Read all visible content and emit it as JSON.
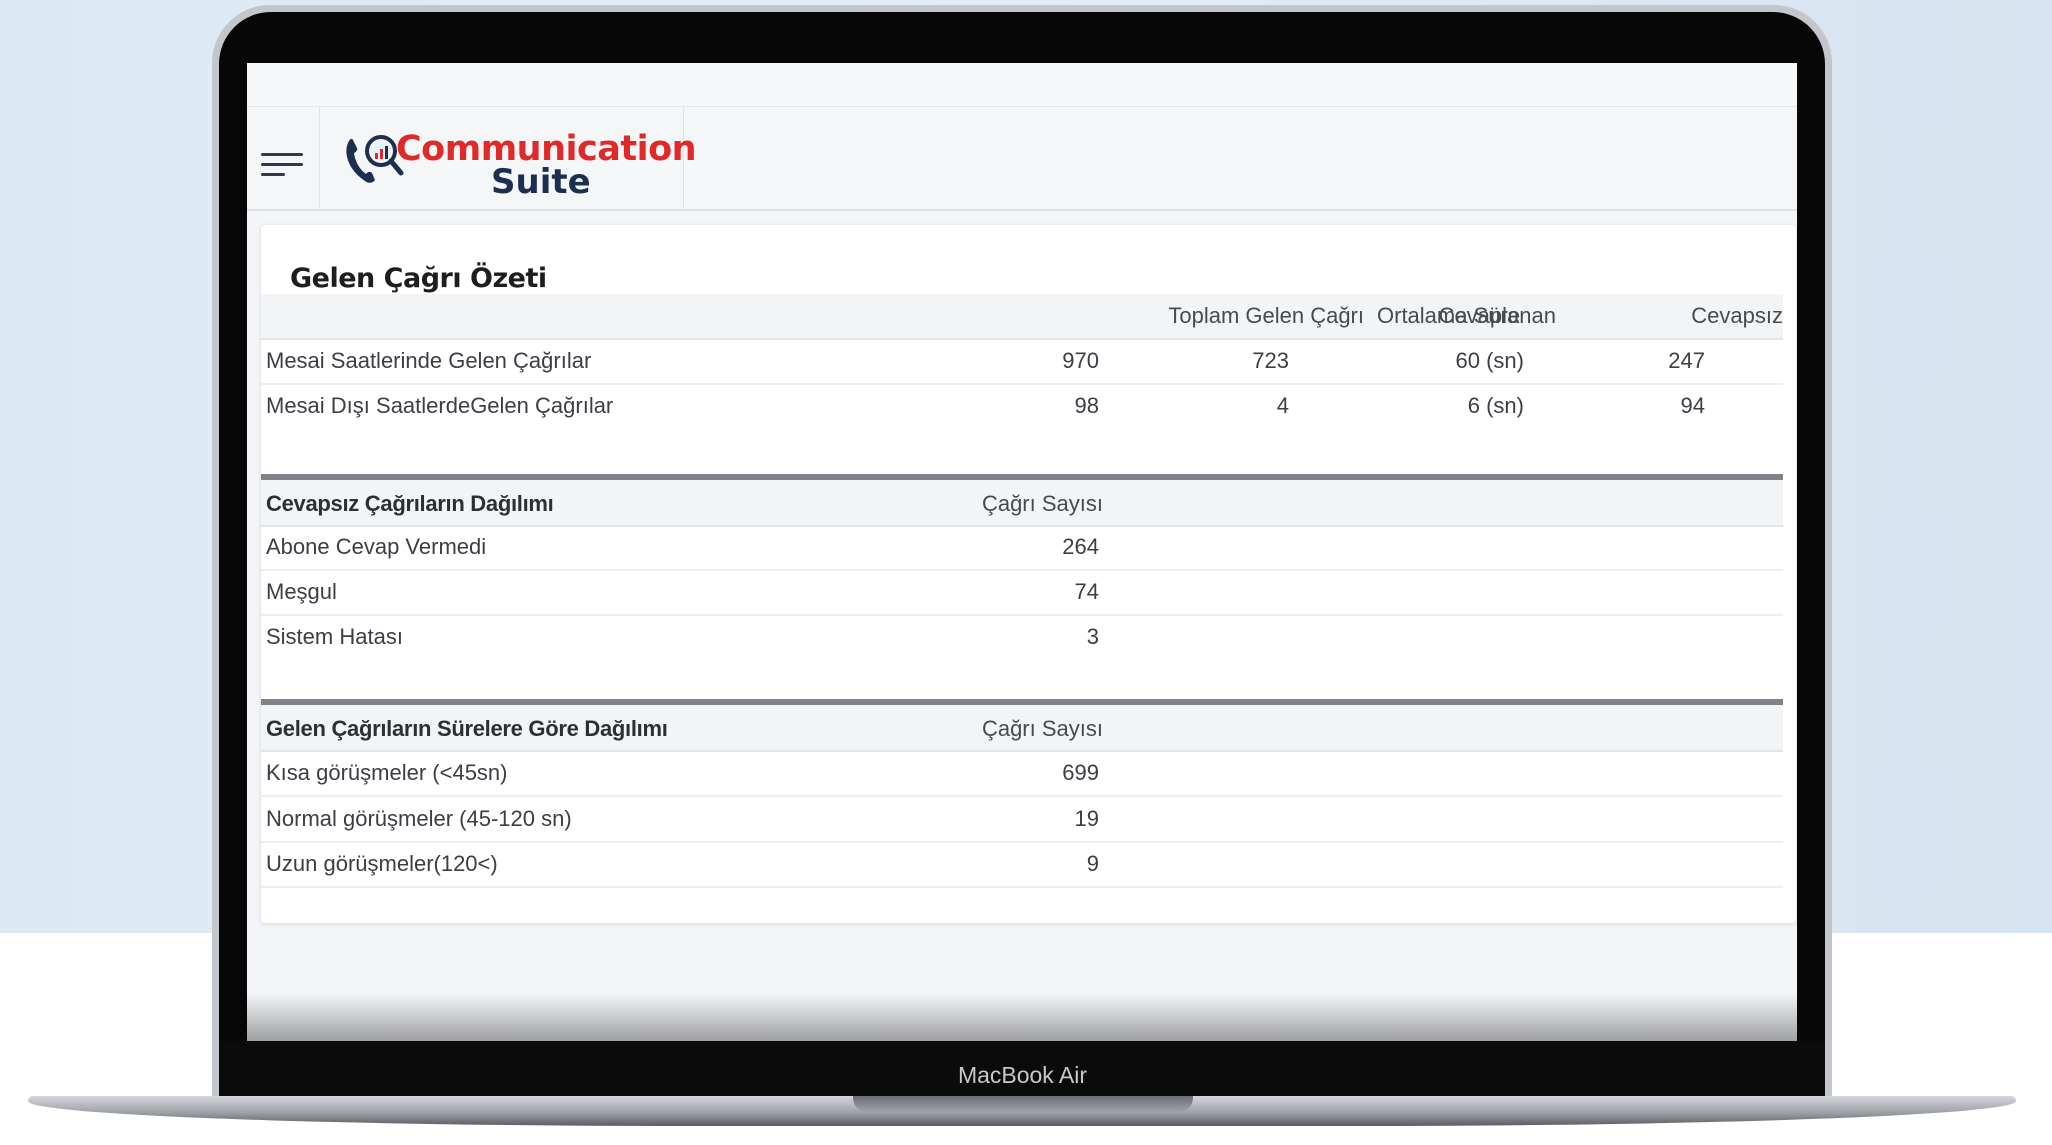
{
  "device": {
    "label": "MacBook Air"
  },
  "app": {
    "logo": {
      "line1": "Communication",
      "line2": "Suite"
    }
  },
  "report": {
    "title": "Gelen Çağrı Özeti",
    "summary": {
      "headers": [
        "",
        "Toplam Gelen Çağrı",
        "Cevaplanan",
        "Ortalama Süre",
        "Cevapsız"
      ],
      "rows": [
        {
          "label": "Mesai Saatlerinde Gelen Çağrılar",
          "total": "970",
          "answered": "723",
          "avg": "60 (sn)",
          "missed": "247"
        },
        {
          "label": "Mesai Dışı SaatlerdeGelen Çağrılar",
          "total": "98",
          "answered": "4",
          "avg": "6 (sn)",
          "missed": "94"
        }
      ]
    },
    "unanswered": {
      "title": "Cevapsız Çağrıların Dağılımı",
      "count_header": "Çağrı Sayısı",
      "rows": [
        {
          "label": "Abone Cevap Vermedi",
          "count": "264"
        },
        {
          "label": "Meşgul",
          "count": "74"
        },
        {
          "label": "Sistem Hatası",
          "count": "3"
        }
      ]
    },
    "duration": {
      "title": "Gelen Çağrıların Sürelere Göre Dağılımı",
      "count_header": "Çağrı Sayısı",
      "rows": [
        {
          "label": "Kısa görüşmeler (<45sn)",
          "count": "699"
        },
        {
          "label": "Normal görüşmeler (45-120 sn)",
          "count": "19"
        },
        {
          "label": "Uzun görüşmeler(120<)",
          "count": "9"
        }
      ]
    }
  },
  "colors": {
    "accent": "#e02a2a",
    "brand_dark": "#1d2f4f",
    "section_bar": "#808488"
  }
}
